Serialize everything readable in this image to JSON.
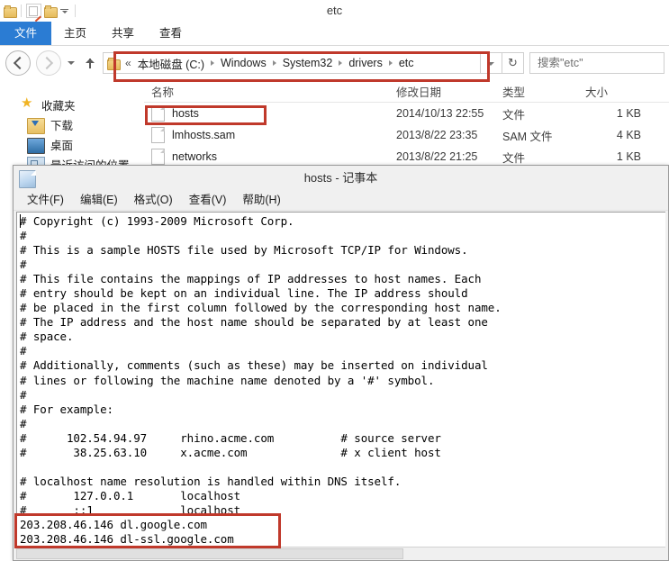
{
  "explorer": {
    "window_title": "etc",
    "quick_access": [
      {
        "name": "folder-icon",
        "label": ""
      },
      {
        "name": "properties-icon",
        "label": ""
      },
      {
        "name": "new-folder-icon",
        "label": ""
      },
      {
        "name": "customize-caret-icon",
        "label": ""
      }
    ],
    "ribbon_tabs": [
      {
        "label": "文件",
        "active": true
      },
      {
        "label": "主页",
        "active": false
      },
      {
        "label": "共享",
        "active": false
      },
      {
        "label": "查看",
        "active": false
      }
    ],
    "address_bar": {
      "overflow_indicator": "«",
      "crumbs": [
        "本地磁盘 (C:)",
        "Windows",
        "System32",
        "drivers",
        "etc"
      ],
      "refresh_glyph": "↻",
      "dropdown_glyph": "⌄"
    },
    "search": {
      "placeholder": "搜索\"etc\"",
      "value": "搜索\"etc\""
    },
    "nav_pane": {
      "items": [
        {
          "label": "收藏夹",
          "icon": "star-icon",
          "level": 0
        },
        {
          "label": "下载",
          "icon": "downloads-icon",
          "level": 1
        },
        {
          "label": "桌面",
          "icon": "desktop-icon",
          "level": 1
        },
        {
          "label": "最近访问的位置",
          "icon": "recent-places-icon",
          "level": 1
        }
      ]
    },
    "file_list": {
      "columns": [
        "名称",
        "修改日期",
        "类型",
        "大小"
      ],
      "rows": [
        {
          "name": "hosts",
          "modified": "2014/10/13 22:55",
          "type": "文件",
          "size": "1 KB"
        },
        {
          "name": "lmhosts.sam",
          "modified": "2013/8/22 23:35",
          "type": "SAM 文件",
          "size": "4 KB"
        },
        {
          "name": "networks",
          "modified": "2013/8/22 21:25",
          "type": "文件",
          "size": "1 KB"
        }
      ]
    }
  },
  "notepad": {
    "title": "hosts - 记事本",
    "menus": [
      "文件(F)",
      "编辑(E)",
      "格式(O)",
      "查看(V)",
      "帮助(H)"
    ],
    "content": "# Copyright (c) 1993-2009 Microsoft Corp.\n#\n# This is a sample HOSTS file used by Microsoft TCP/IP for Windows.\n#\n# This file contains the mappings of IP addresses to host names. Each\n# entry should be kept on an individual line. The IP address should\n# be placed in the first column followed by the corresponding host name.\n# The IP address and the host name should be separated by at least one\n# space.\n#\n# Additionally, comments (such as these) may be inserted on individual\n# lines or following the machine name denoted by a '#' symbol.\n#\n# For example:\n#\n#      102.54.94.97     rhino.acme.com          # source server\n#       38.25.63.10     x.acme.com              # x client host\n\n# localhost name resolution is handled within DNS itself.\n#\t127.0.0.1       localhost\n#\t::1             localhost\n203.208.46.146 dl.google.com\n203.208.46.146 dl-ssl.google.com"
  },
  "annotations": {
    "highlight_color": "#c0392b",
    "boxes": [
      {
        "name": "address-bar-highlight",
        "target": "address bar breadcrumb path"
      },
      {
        "name": "hosts-file-highlight",
        "target": "hosts file row"
      },
      {
        "name": "host-entries-highlight",
        "target": "google host entry lines"
      }
    ]
  }
}
